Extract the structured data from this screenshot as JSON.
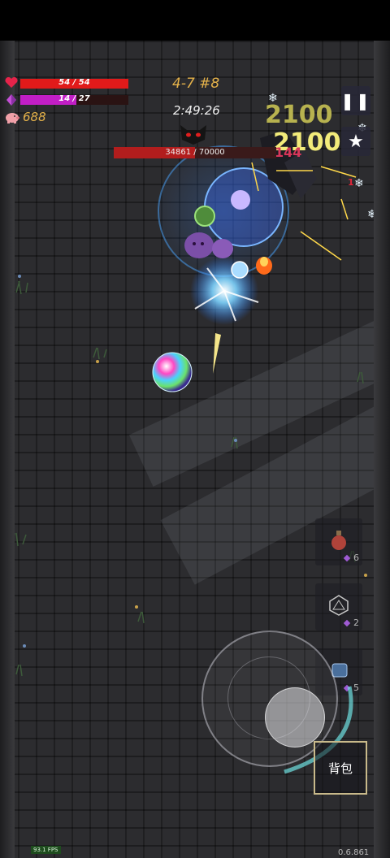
{
  "hud": {
    "hp_text": "54 / 54",
    "hp_fraction": 1.0,
    "mana_text": "14 / 27",
    "mana_fraction": 0.52,
    "coins": "688",
    "stage": "4-7 #8",
    "timer": "2:49:26",
    "boss_hp_text": "34861 / 70000",
    "boss_hp_fraction": 0.498
  },
  "damage_numbers": [
    "2100",
    "2100",
    "144",
    "1"
  ],
  "buttons": {
    "pause_icon": "pause-icon",
    "favorite_icon": "star-icon",
    "bag_label": "背包"
  },
  "item_slots": [
    {
      "icon": "potion-icon",
      "count": "6"
    },
    {
      "icon": "dice-icon",
      "count": "2"
    },
    {
      "icon": "scroll-icon",
      "count": "5"
    }
  ],
  "footer": {
    "fps": "93.1 FPS",
    "version": "0.6.861"
  },
  "colors": {
    "hp": "#e11a1a",
    "mana": "#c21ec6",
    "gold": "#e5b24a",
    "boss_bar": "#b21d1d"
  }
}
